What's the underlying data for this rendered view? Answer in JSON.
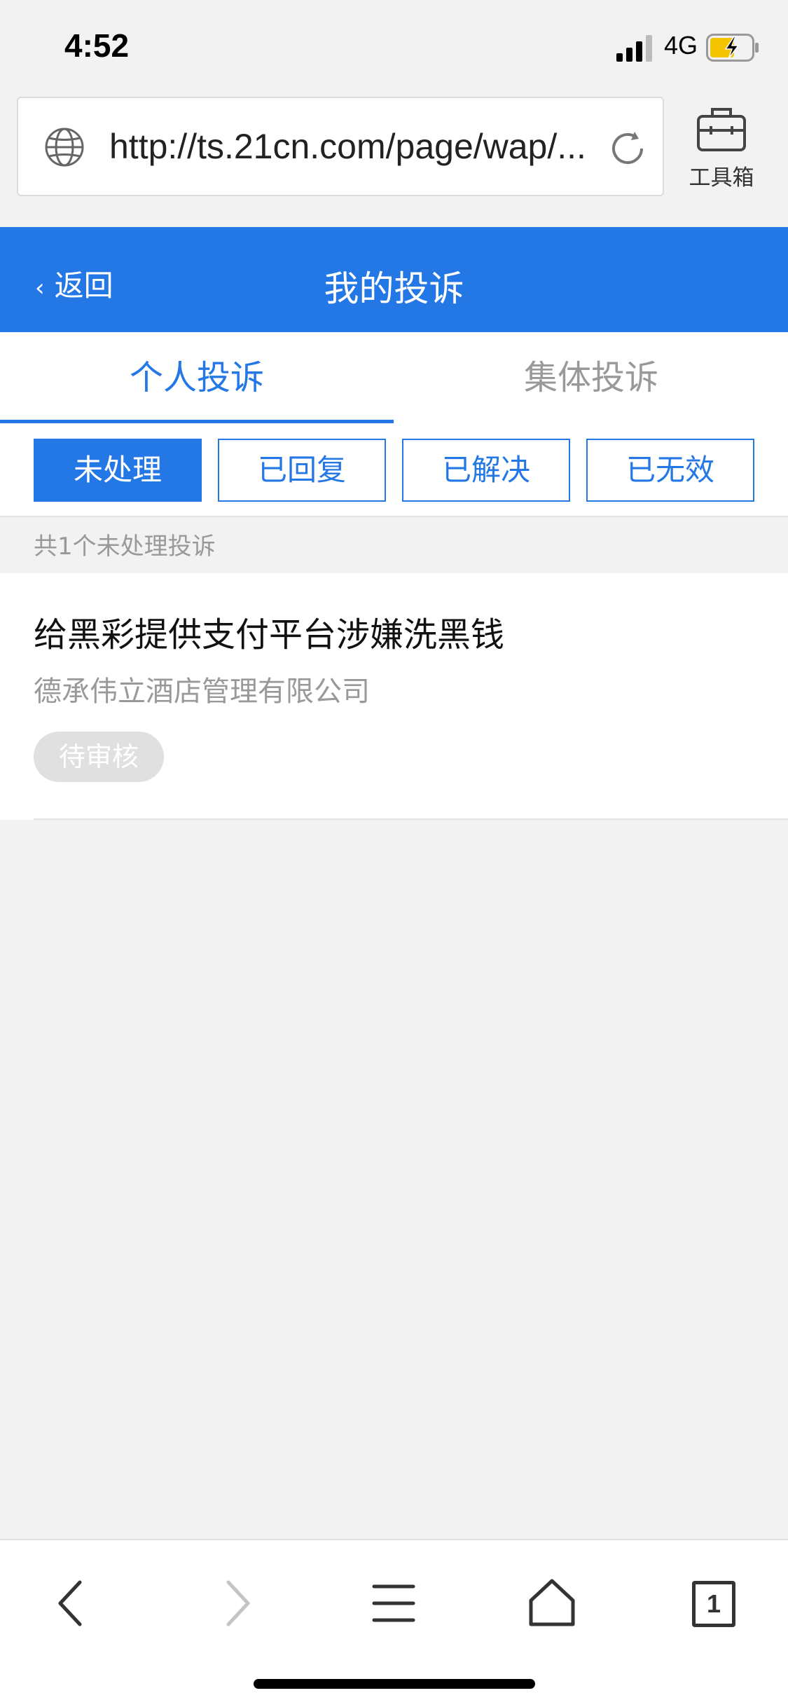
{
  "status_bar": {
    "time": "4:52",
    "network": "4G"
  },
  "browser": {
    "url": "http://ts.21cn.com/page/wap/...",
    "toolbox_label": "工具箱"
  },
  "header": {
    "back_label": "返回",
    "back_chevron": "‹",
    "title": "我的投诉"
  },
  "tabs": [
    {
      "label": "个人投诉",
      "active": true
    },
    {
      "label": "集体投诉",
      "active": false
    }
  ],
  "filters": [
    {
      "label": "未处理",
      "selected": true
    },
    {
      "label": "已回复",
      "selected": false
    },
    {
      "label": "已解决",
      "selected": false
    },
    {
      "label": "已无效",
      "selected": false
    }
  ],
  "summary": "共1个未处理投诉",
  "complaints": [
    {
      "title": "给黑彩提供支付平台涉嫌洗黑钱",
      "company": "德承伟立酒店管理有限公司",
      "status": "待审核"
    }
  ],
  "bottom_nav": {
    "icons": [
      "back-arrow-icon",
      "forward-arrow-icon",
      "menu-icon",
      "home-icon",
      "tabs-icon"
    ],
    "tab_count": "1"
  },
  "colors": {
    "accent": "#2478e6",
    "background": "#f2f2f2",
    "muted_text": "#999999"
  }
}
